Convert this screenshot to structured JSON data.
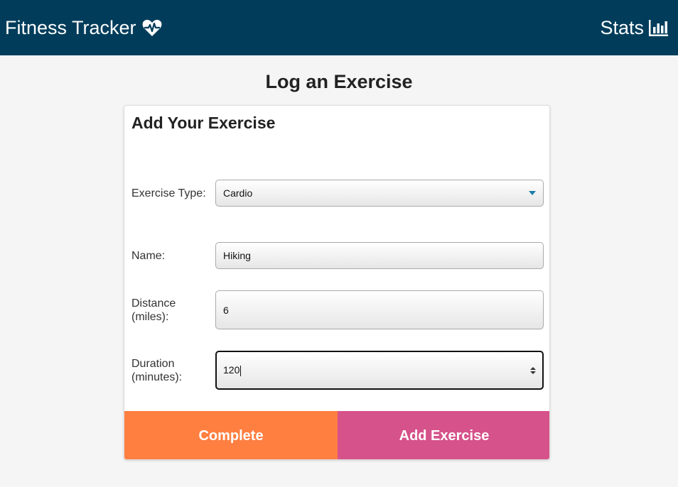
{
  "navbar": {
    "brand": "Fitness Tracker",
    "brand_icon": "heartbeat-icon",
    "stats_label": "Stats",
    "stats_icon": "bar-chart-icon",
    "background": "#013d5b"
  },
  "page": {
    "title": "Log an Exercise"
  },
  "form": {
    "card_title": "Add Your Exercise",
    "exercise_type": {
      "label": "Exercise Type:",
      "value": "Cardio"
    },
    "name": {
      "label": "Name:",
      "value": "Hiking"
    },
    "distance": {
      "label_line1": "Distance",
      "label_line2": "(miles):",
      "value": "6"
    },
    "duration": {
      "label_line1": "Duration",
      "label_line2": "(minutes):",
      "value": "120"
    }
  },
  "buttons": {
    "complete_label": "Complete",
    "add_label": "Add Exercise",
    "complete_color": "#ff7f41",
    "add_color": "#d6528a"
  }
}
